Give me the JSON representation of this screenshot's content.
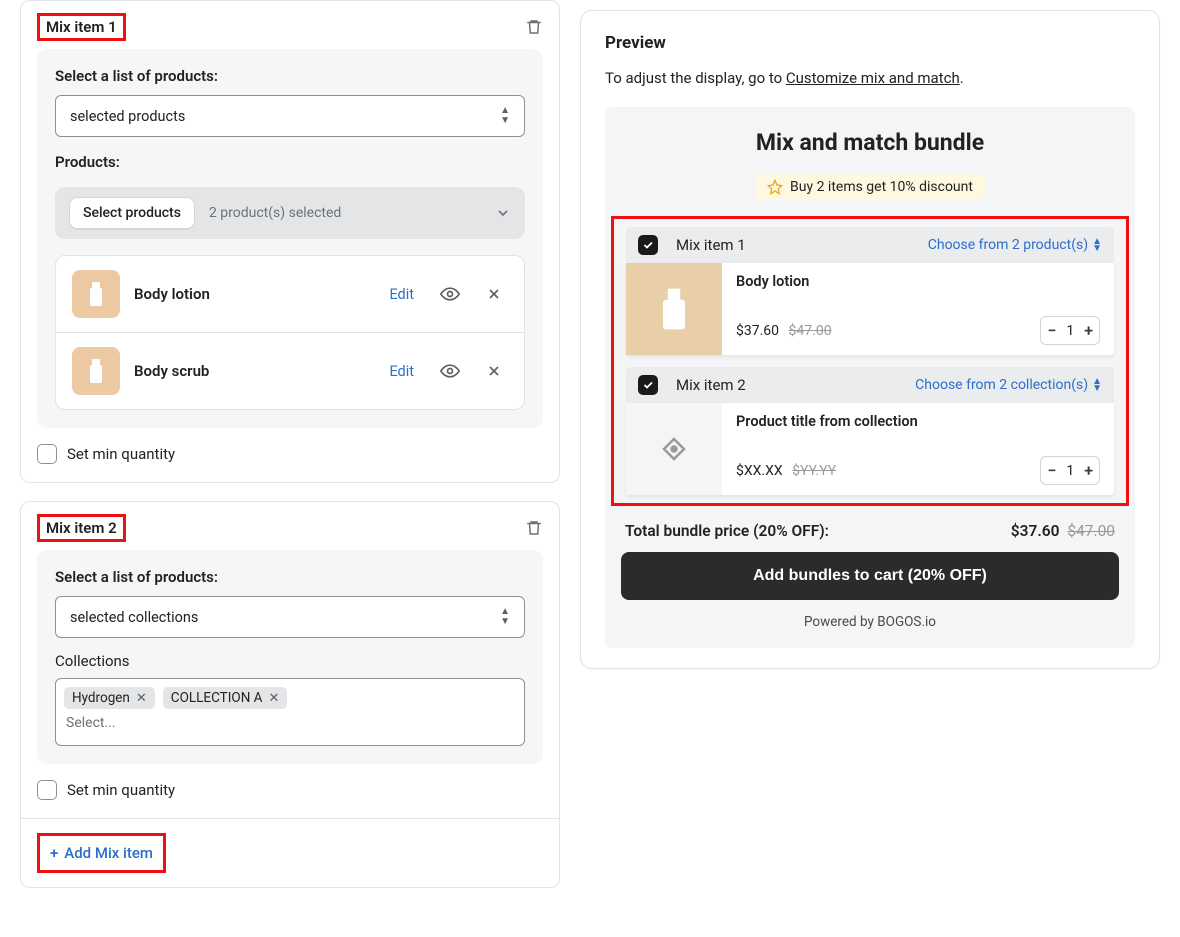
{
  "left": {
    "item1": {
      "title": "Mix item 1",
      "select_label": "Select a list of products:",
      "select_value": "selected products",
      "products_label": "Products:",
      "select_products_btn": "Select products",
      "selected_count": "2 product(s) selected",
      "rows": [
        {
          "name": "Body lotion",
          "edit": "Edit"
        },
        {
          "name": "Body scrub",
          "edit": "Edit"
        }
      ],
      "min_qty": "Set min quantity"
    },
    "item2": {
      "title": "Mix item 2",
      "select_label": "Select a list of products:",
      "select_value": "selected collections",
      "collections_label": "Collections",
      "tags": [
        "Hydrogen",
        "COLLECTION A"
      ],
      "placeholder": "Select...",
      "min_qty": "Set min quantity"
    },
    "add_link": "Add Mix item"
  },
  "preview": {
    "title": "Preview",
    "sub_prefix": "To adjust the display, go to ",
    "sub_link": "Customize mix and match",
    "bundle_title": "Mix and match bundle",
    "promo": "Buy 2 items get 10% discount",
    "sec1": {
      "title": "Mix item 1",
      "choose": "Choose from 2 product(s)",
      "product": "Body lotion",
      "price": "$37.60",
      "old": "$47.00",
      "qty": "1"
    },
    "sec2": {
      "title": "Mix item 2",
      "choose": "Choose from 2 collection(s)",
      "product": "Product title from collection",
      "price": "$XX.XX",
      "old": "$YY.YY",
      "qty": "1"
    },
    "total_label": "Total bundle price (20% OFF):",
    "total_price": "$37.60",
    "total_old": "$47.00",
    "cta": "Add bundles to cart (20% OFF)",
    "powered": "Powered by BOGOS.io"
  }
}
